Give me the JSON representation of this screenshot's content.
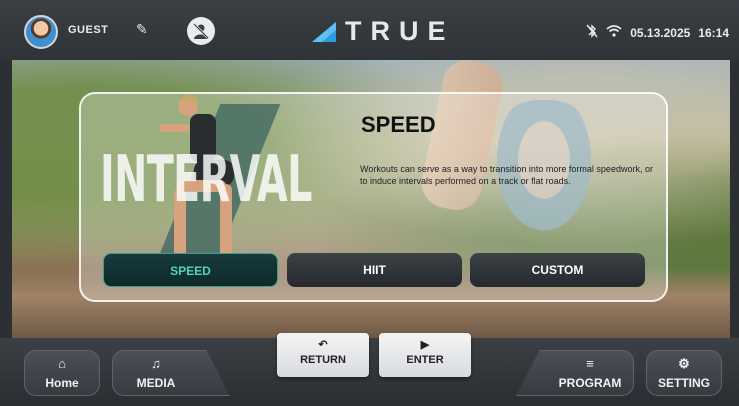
{
  "header": {
    "user_name": "GUEST",
    "logo_text": "TRUE",
    "date": "05.13.2025",
    "time": "16:14",
    "icons": [
      "avatar",
      "pencil-icon",
      "privacy-icon",
      "bluetooth-off-icon",
      "wifi-icon"
    ]
  },
  "program": {
    "category_watermark": "INTERVAL",
    "title": "SPEED",
    "description": "Workouts can serve as a way to transition into more formal speedwork, or to induce intervals performed on a track or flat roads.",
    "modes": [
      {
        "label": "SPEED",
        "selected": true
      },
      {
        "label": "HIIT",
        "selected": false
      },
      {
        "label": "CUSTOM",
        "selected": false
      }
    ]
  },
  "footer": {
    "home_label": "Home",
    "media_label": "MEDIA",
    "return_label": "RETURN",
    "enter_label": "ENTER",
    "program_label": "PROGRAM",
    "setting_label": "SETTING"
  },
  "colors": {
    "accent": "#4fd4b8",
    "logo_mark": "#2f9be0",
    "bar": "#33383c"
  }
}
